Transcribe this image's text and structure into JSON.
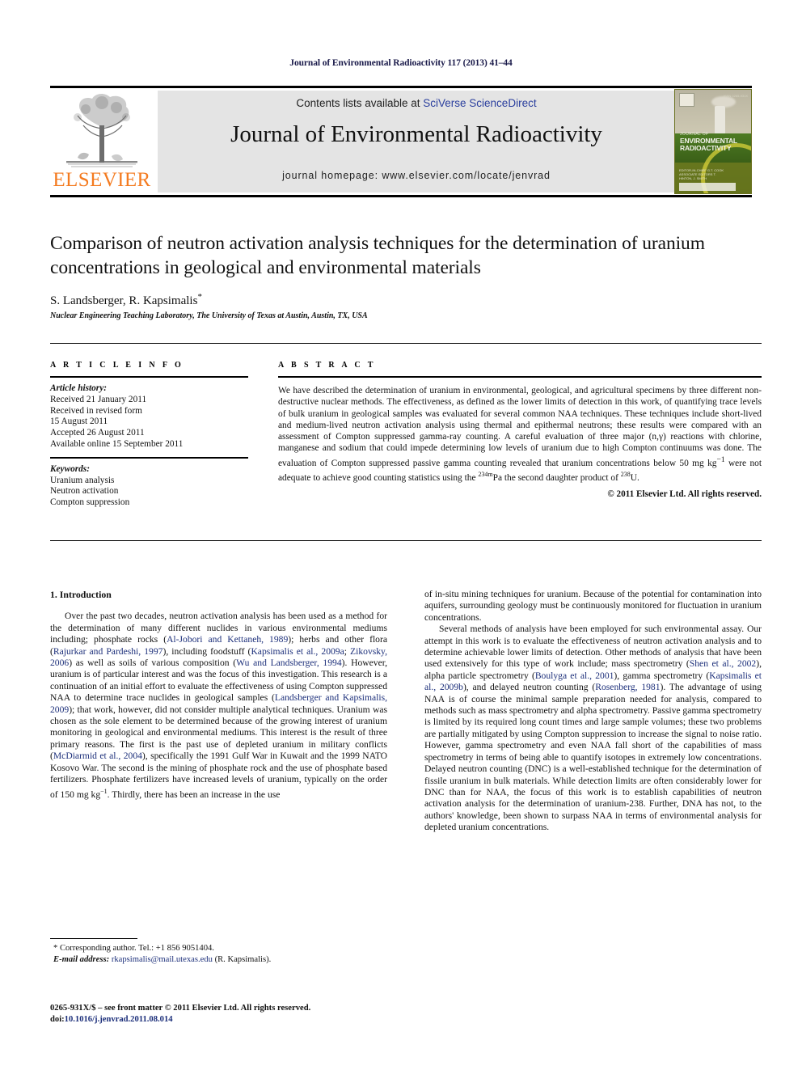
{
  "running_head": "Journal of Environmental Radioactivity 117 (2013) 41–44",
  "masthead": {
    "publisher_wordmark": "ELSEVIER",
    "contents_prefix": "Contents lists available at ",
    "contents_link": "SciVerse ScienceDirect",
    "journal_title": "Journal of Environmental Radioactivity",
    "homepage": "journal homepage: www.elsevier.com/locate/jenvrad",
    "cover": {
      "kicker": "JOURNAL OF",
      "title": "ENVIRONMENTAL RADIOACTIVITY",
      "issn_corner": "ISSN 0265-931X",
      "footer_lines": "EDITOR-IN-CHIEF\nG.T. COOK\nASSOCIATE EDITORS\nT. HINTON, J. SMITH"
    }
  },
  "article": {
    "title": "Comparison of neutron activation analysis techniques for the determination of uranium concentrations in geological and environmental materials",
    "authors": "S. Landsberger, R. Kapsimalis",
    "author_marker": "*",
    "affiliation": "Nuclear Engineering Teaching Laboratory, The University of Texas at Austin, Austin, TX, USA"
  },
  "article_info": {
    "heading": "A R T I C L E   I N F O",
    "history_label": "Article history:",
    "history": [
      "Received 21 January 2011",
      "Received in revised form",
      "15 August 2011",
      "Accepted 26 August 2011",
      "Available online 15 September 2011"
    ],
    "keywords_label": "Keywords:",
    "keywords": [
      "Uranium analysis",
      "Neutron activation",
      "Compton suppression"
    ]
  },
  "abstract": {
    "heading": "A B S T R A C T",
    "part1": "We have described the determination of uranium in environmental, geological, and agricultural specimens by three different non-destructive nuclear methods. The effectiveness, as defined as the lower limits of detection in this work, of quantifying trace levels of bulk uranium in geological samples was evaluated for several common NAA techniques. These techniques include short-lived and medium-lived neutron activation analysis using thermal and epithermal neutrons; these results were compared with an assessment of Compton suppressed gamma-ray counting. A careful evaluation of three major (n,γ) reactions with chlorine, manganese and sodium that could impede determining low levels of uranium due to high Compton continuums was done. The evaluation of Compton suppressed passive gamma counting revealed that uranium concentrations below 50 mg kg",
    "sup1": "−1",
    "part2": " were not adequate to achieve good counting statistics using the ",
    "sup2": "234m",
    "part3": "Pa the second daughter product of ",
    "sup3": "238",
    "part4": "U.",
    "copyright": "© 2011 Elsevier Ltd. All rights reserved."
  },
  "body": {
    "section_heading": "1. Introduction",
    "left": {
      "p1_a": "Over the past two decades, neutron activation analysis has been used as a method for the determination of many different nuclides in various environmental mediums including; phosphate rocks (",
      "r1": "Al-Jobori and Kettaneh, 1989",
      "p1_b": "); herbs and other flora (",
      "r2": "Rajurkar and Pardeshi, 1997",
      "p1_c": "), including foodstuff (",
      "r3": "Kapsimalis et al., 2009a",
      "p1_d": "; ",
      "r4": "Zikovsky, 2006",
      "p1_e": ") as well as soils of various composition (",
      "r5": "Wu and Landsberger, 1994",
      "p1_f": "). However, uranium is of particular interest and was the focus of this investigation. This research is a continuation of an initial effort to evaluate the effectiveness of using Compton suppressed NAA to determine trace nuclides in geological samples (",
      "r6": "Landsberger and Kapsimalis, 2009",
      "p1_g": "); that work, however, did not consider multiple analytical techniques. Uranium was chosen as the sole element to be determined because of the growing interest of uranium monitoring in geological and environmental mediums. This interest is the result of three primary reasons. The first is the past use of depleted uranium in military conflicts (",
      "r7": "McDiarmid et al., 2004",
      "p1_h": "), specifically the 1991 Gulf War in Kuwait and the 1999 NATO Kosovo War. The second is the mining of phosphate rock and the use of phosphate based fertilizers. Phosphate fertilizers have increased levels of uranium, typically on the order of 150 mg kg",
      "sup_a": "−1",
      "p1_i": ". Thirdly, there has been an increase in the use"
    },
    "right": {
      "p1_cont": "of in-situ mining techniques for uranium. Because of the potential for contamination into aquifers, surrounding geology must be continuously monitored for fluctuation in uranium concentrations.",
      "p2_a": "Several methods of analysis have been employed for such environmental assay. Our attempt in this work is to evaluate the effectiveness of neutron activation analysis and to determine achievable lower limits of detection. Other methods of analysis that have been used extensively for this type of work include; mass spectrometry (",
      "r1": "Shen et al., 2002",
      "p2_b": "), alpha particle spectrometry (",
      "r2": "Boulyga et al., 2001",
      "p2_c": "), gamma spectrometry (",
      "r3": "Kapsimalis et al., 2009b",
      "p2_d": "), and delayed neutron counting (",
      "r4": "Rosenberg, 1981",
      "p2_e": "). The advantage of using NAA is of course the minimal sample preparation needed for analysis, compared to methods such as mass spectrometry and alpha spectrometry. Passive gamma spectrometry is limited by its required long count times and large sample volumes; these two problems are partially mitigated by using Compton suppression to increase the signal to noise ratio. However, gamma spectrometry and even NAA fall short of the capabilities of mass spectrometry in terms of being able to quantify isotopes in extremely low concentrations. Delayed neutron counting (DNC) is a well-established technique for the determination of fissile uranium in bulk materials. While detection limits are often considerably lower for DNC than for NAA, the focus of this work is to establish capabilities of neutron activation analysis for the determination of uranium-238. Further, DNA has not, to the authors' knowledge, been shown to surpass NAA in terms of environmental analysis for depleted uranium concentrations."
    }
  },
  "footnotes": {
    "corresponding": "* Corresponding author. Tel.: +1 856 9051404.",
    "email_label": "E-mail address:",
    "email": "rkapsimalis@mail.utexas.edu",
    "email_suffix": "(R. Kapsimalis).",
    "imprint": "0265-931X/$ – see front matter © 2011 Elsevier Ltd. All rights reserved.",
    "doi_label": "doi:",
    "doi": "10.1016/j.jenvrad.2011.08.014"
  },
  "colors": {
    "link_blue": "#1c2f7a",
    "sciencedirect_blue": "#2b3f9e",
    "elsevier_orange": "#F47B20",
    "band_gray": "#e4e4e4"
  }
}
